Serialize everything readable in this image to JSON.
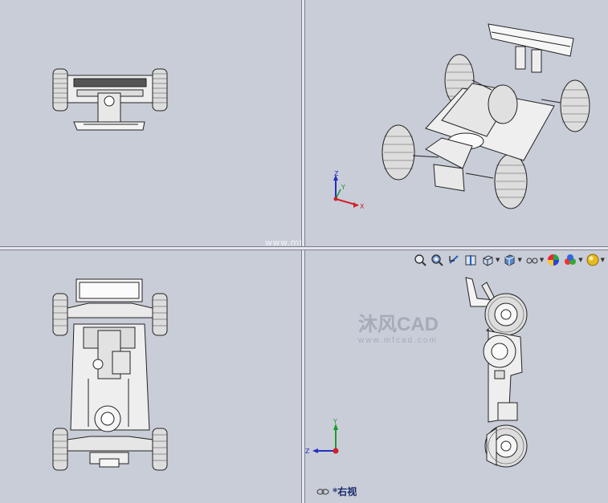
{
  "colors": {
    "viewport_bg": "#c9cdd8",
    "axis_x": "#d0202a",
    "axis_y": "#1a9a2a",
    "axis_z": "#2030c0",
    "label": "#1a2a6a"
  },
  "watermark": {
    "url": "www.mfcad.com"
  },
  "logo": {
    "title": "沐风CAD",
    "url": "www.mfcad.com"
  },
  "axes": {
    "x": "X",
    "y": "Y",
    "z": "Z"
  },
  "bottom_right_view": {
    "label": "*右视"
  },
  "toolbar": {
    "icons": [
      "zoom-to-fit-icon",
      "zoom-to-area-icon",
      "previous-view-icon",
      "section-view-icon",
      "view-orientation-icon",
      "display-style-icon",
      "hide-show-items-icon",
      "edit-appearance-icon",
      "apply-scene-icon",
      "view-settings-icon"
    ]
  }
}
